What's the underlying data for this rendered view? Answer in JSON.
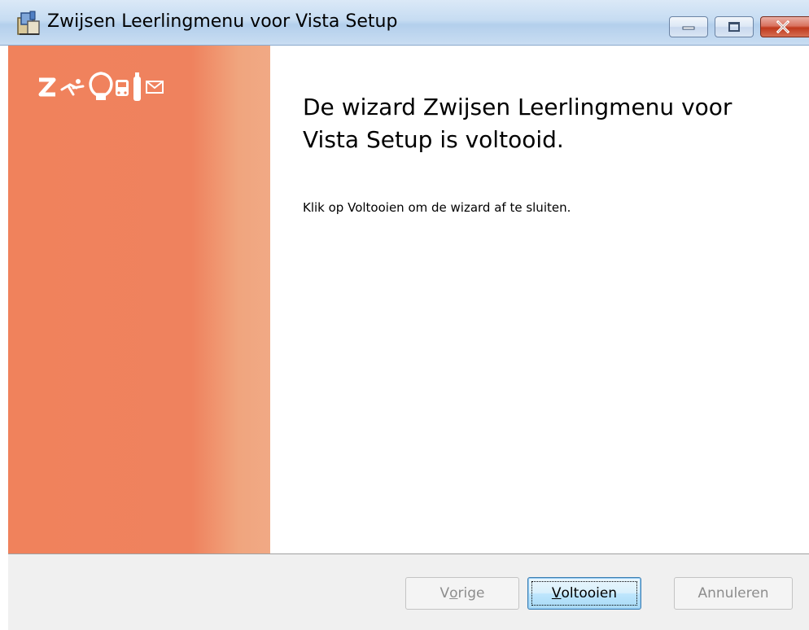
{
  "window": {
    "title": "Zwijsen Leerlingmenu voor Vista Setup",
    "controls": {
      "minimize_icon": "minimize-icon",
      "maximize_icon": "maximize-icon",
      "close_icon": "close-icon"
    }
  },
  "banner": {
    "logo_icon": "zwijsen-logo-icon",
    "color": "#F0825C"
  },
  "content": {
    "heading": "De wizard Zwijsen Leerlingmenu voor Vista Setup is voltooid.",
    "message": "Klik op Voltooien om de wizard af te sluiten."
  },
  "buttons": {
    "previous": {
      "label_pre": "V",
      "label_accel": "o",
      "label_post": "rige",
      "enabled": false
    },
    "finish": {
      "label_pre": "",
      "label_accel": "V",
      "label_post": "oltooien",
      "enabled": true,
      "default": true
    },
    "cancel": {
      "label_pre": "",
      "label_accel": "",
      "label_post": "Annuleren",
      "enabled": false
    }
  },
  "colors": {
    "banner_orange": "#F0825C",
    "close_red": "#C0391C",
    "titlebar_blue": "#C6DCF2"
  }
}
